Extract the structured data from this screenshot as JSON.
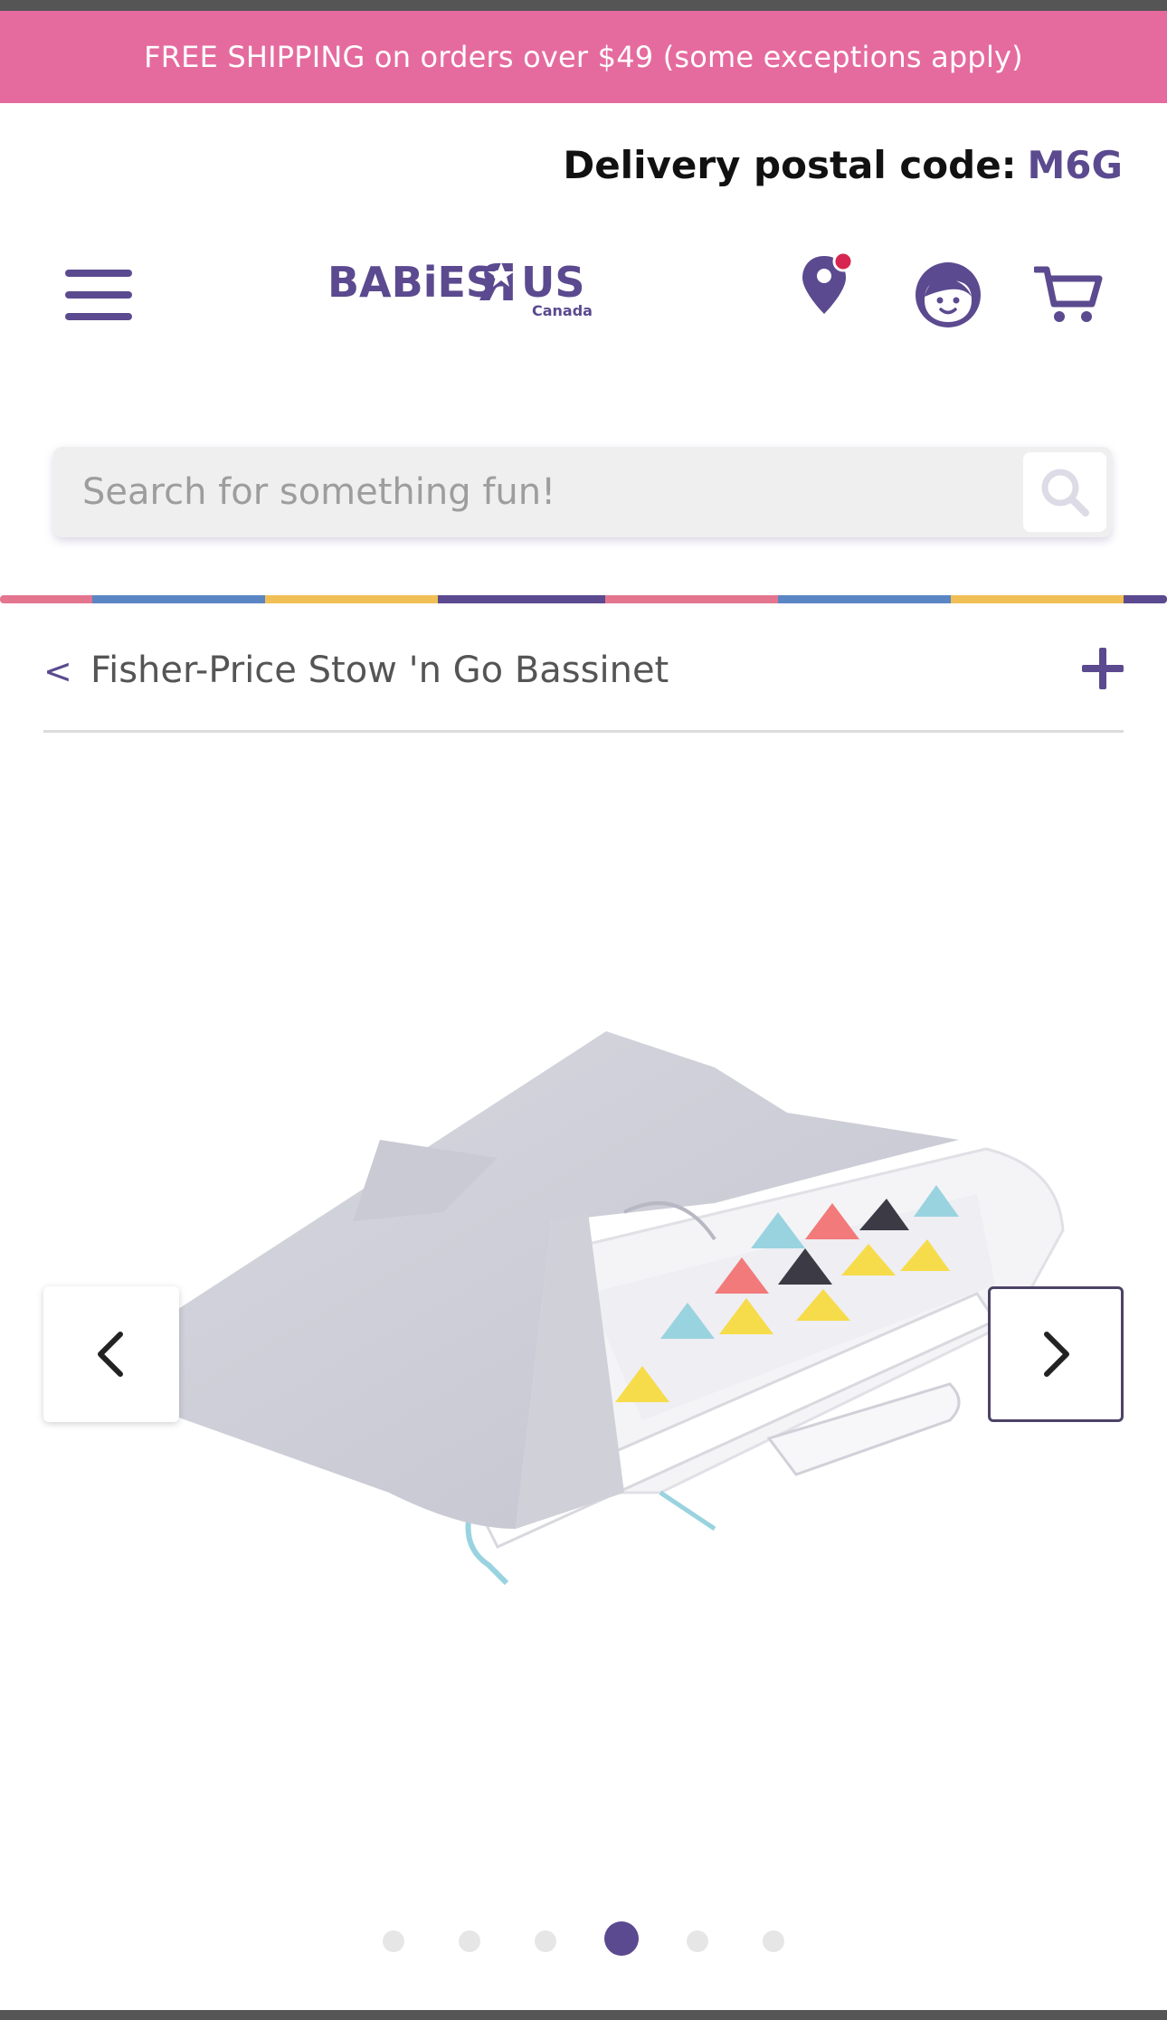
{
  "promo_banner": {
    "text": "FREE SHIPPING on orders over $49 (some exceptions apply)"
  },
  "delivery": {
    "label": "Delivery postal code:",
    "postal_code": "M6G"
  },
  "header": {
    "logo_text": "BABiES",
    "logo_text_2": "US",
    "logo_subtext": "Canada",
    "icons": [
      "hamburger-menu-icon",
      "location-pin-icon",
      "account-icon",
      "cart-icon"
    ]
  },
  "search": {
    "placeholder": "Search for something fun!"
  },
  "breadcrumb": {
    "back_symbol": "<",
    "title": "Fisher-Price Stow 'n Go Bassinet",
    "expand_icon": "plus-icon"
  },
  "carousel": {
    "slide_count": 6,
    "active_index": 3
  },
  "colors": {
    "brand_purple": "#5b4a8f",
    "promo_pink": "#e56b9f",
    "stripe": [
      "#e3758f",
      "#5b86c4",
      "#f0bf55",
      "#5b4a8f"
    ]
  }
}
